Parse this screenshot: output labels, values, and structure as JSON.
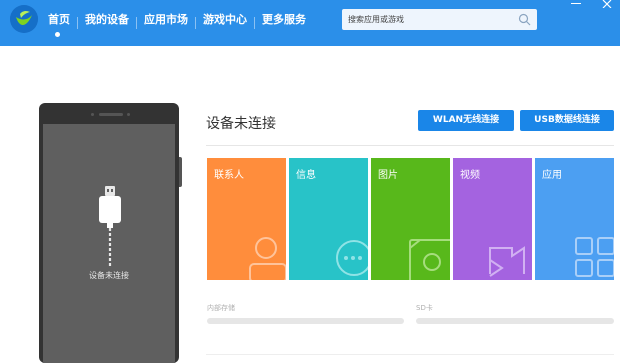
{
  "topbar": {
    "color": "#2b8fe9",
    "logo_icon": "pea-pod-logo-icon",
    "nav": [
      {
        "label": "首页",
        "active": true
      },
      {
        "label": "我的设备",
        "active": false
      },
      {
        "label": "应用市场",
        "active": false
      },
      {
        "label": "游戏中心",
        "active": false
      },
      {
        "label": "更多服务",
        "active": false
      }
    ],
    "search_placeholder": "搜索应用或游戏",
    "search_icon": "search-icon",
    "window_controls": [
      "minimize-icon",
      "close-icon"
    ]
  },
  "phone": {
    "status_text": "设备未连接",
    "cable_icon": "usb-cable-icon"
  },
  "main": {
    "title": "设备未连接",
    "buttons": {
      "wlan": "WLAN无线连接",
      "usb": "USB数据线连接"
    },
    "tiles": [
      {
        "label": "联系人",
        "color": "#ff8d3c",
        "icon": "contacts-icon"
      },
      {
        "label": "信息",
        "color": "#28c3c8",
        "icon": "message-icon"
      },
      {
        "label": "图片",
        "color": "#58b81b",
        "icon": "picture-icon"
      },
      {
        "label": "视频",
        "color": "#a463e0",
        "icon": "video-icon"
      },
      {
        "label": "应用",
        "color": "#4c9ff2",
        "icon": "apps-icon"
      }
    ],
    "storage": [
      {
        "label": "内部存储"
      },
      {
        "label": "SD卡"
      }
    ]
  },
  "colors": {
    "accent": "#1a86e8",
    "phone_body": "#333333",
    "phone_screen": "#5f5f5f"
  }
}
